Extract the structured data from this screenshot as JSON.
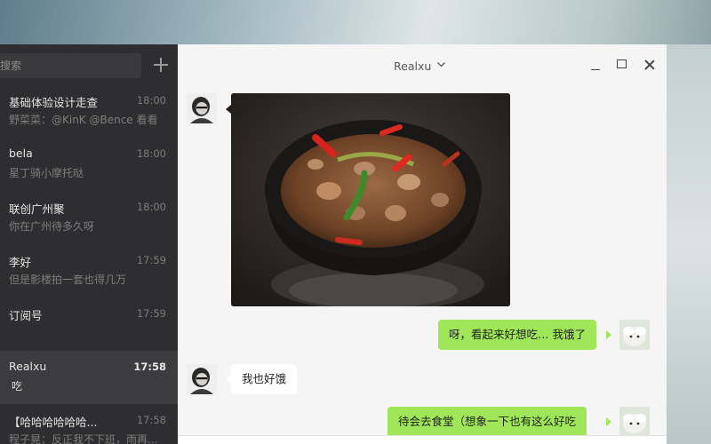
{
  "sidebar": {
    "search_placeholder": "搜索",
    "search_visible": "搜索",
    "add_icon": "plus-icon",
    "conversations": [
      {
        "name": "基础体验设计走查",
        "time": "18:00",
        "preview": "野菜菜：@KinK @Bence 看看"
      },
      {
        "name": "bela",
        "time": "18:00",
        "preview": "星丁骑小摩托哒"
      },
      {
        "name": "联创广州聚",
        "time": "18:00",
        "preview": "你在广州待多久呀"
      },
      {
        "name": "李好",
        "time": "17:59",
        "preview": "但是影楼拍一套也得几万"
      },
      {
        "name": "订阅号",
        "time": "17:59",
        "preview": ""
      },
      {
        "name": "Realxu",
        "time": "17:58",
        "preview": "吃",
        "active": true
      },
      {
        "name": "【哈哈哈哈哈哈...",
        "time": "17:58",
        "preview": "程子晃：反正我不下班，雨再..."
      }
    ]
  },
  "chat": {
    "title": "Realxu",
    "messages": [
      {
        "from": "other",
        "type": "image",
        "alt": "砂锅菜"
      },
      {
        "from": "me",
        "type": "text",
        "text": "呀，看起来好想吃… 我饿了"
      },
      {
        "from": "other",
        "type": "text",
        "text": "我也好饿"
      },
      {
        "from": "me",
        "type": "text",
        "text": "待会去食堂（想象一下也有这么好吃"
      }
    ]
  },
  "colors": {
    "sidebar_bg": "#2e2e30",
    "active_item_bg": "#3c3c3e",
    "chat_bg": "#f5f5f5",
    "my_bubble": "#9fe658",
    "other_bubble": "#ffffff"
  }
}
